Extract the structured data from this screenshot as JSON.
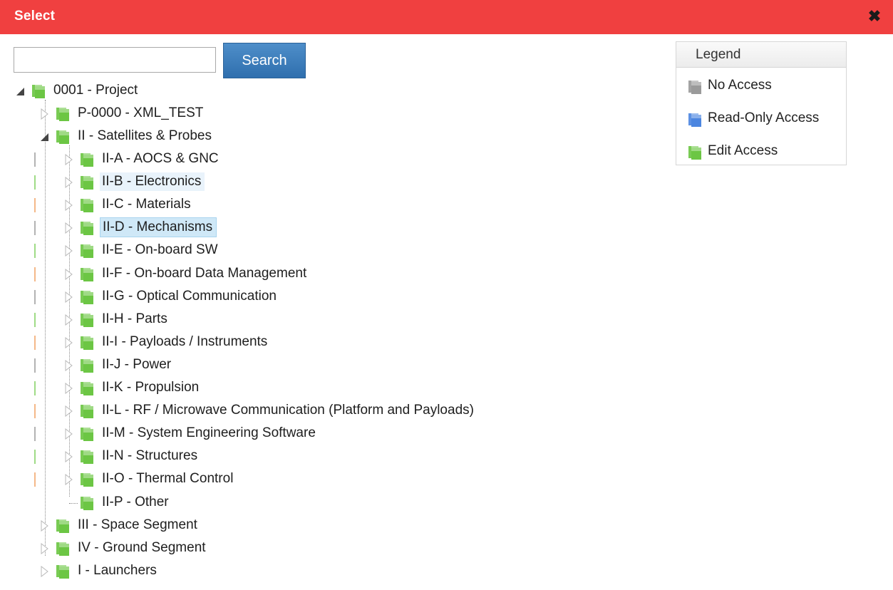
{
  "dialog": {
    "title": "Select",
    "close_icon": "close-icon"
  },
  "search": {
    "value": "",
    "placeholder": "",
    "button_label": "Search"
  },
  "legend": {
    "title": "Legend",
    "items": [
      {
        "label": "No Access",
        "icon": "folder-gray-icon",
        "color": "#9a9a9a"
      },
      {
        "label": "Read-Only Access",
        "icon": "folder-blue-icon",
        "color": "#4c86e0"
      },
      {
        "label": "Edit Access",
        "icon": "folder-green-icon",
        "color": "#6cc644"
      }
    ]
  },
  "colors": {
    "titlebar": "#f04040",
    "button": "#3a7fc1",
    "folder_edit": "#6cc644",
    "selected_bg": "#cfe8f7",
    "hover_bg": "#e9f3fb"
  },
  "tree": {
    "root": {
      "label": "0001 - Project",
      "expanded": true
    },
    "level1": [
      {
        "label": "P-0000 - XML_TEST",
        "expanded": false
      },
      {
        "label": "II - Satellites & Probes",
        "expanded": true
      },
      {
        "label": "III - Space Segment",
        "expanded": false
      },
      {
        "label": "IV - Ground Segment",
        "expanded": false
      },
      {
        "label": "I - Launchers",
        "expanded": false
      }
    ],
    "children": [
      {
        "label": "II-A - AOCS & GNC",
        "state": ""
      },
      {
        "label": "II-B - Electronics",
        "state": "hover"
      },
      {
        "label": "II-C - Materials",
        "state": ""
      },
      {
        "label": "II-D - Mechanisms",
        "state": "selected"
      },
      {
        "label": "II-E - On-board SW",
        "state": ""
      },
      {
        "label": "II-F - On-board Data Management",
        "state": ""
      },
      {
        "label": "II-G - Optical Communication",
        "state": ""
      },
      {
        "label": "II-H - Parts",
        "state": ""
      },
      {
        "label": "II-I - Payloads / Instruments",
        "state": ""
      },
      {
        "label": "II-J - Power",
        "state": ""
      },
      {
        "label": "II-K - Propulsion",
        "state": ""
      },
      {
        "label": "II-L - RF / Microwave Communication (Platform and Payloads)",
        "state": ""
      },
      {
        "label": "II-M - System Engineering Software",
        "state": ""
      },
      {
        "label": "II-N - Structures",
        "state": ""
      },
      {
        "label": "II-O - Thermal Control",
        "state": ""
      },
      {
        "label": "II-P - Other",
        "state": ""
      }
    ]
  }
}
